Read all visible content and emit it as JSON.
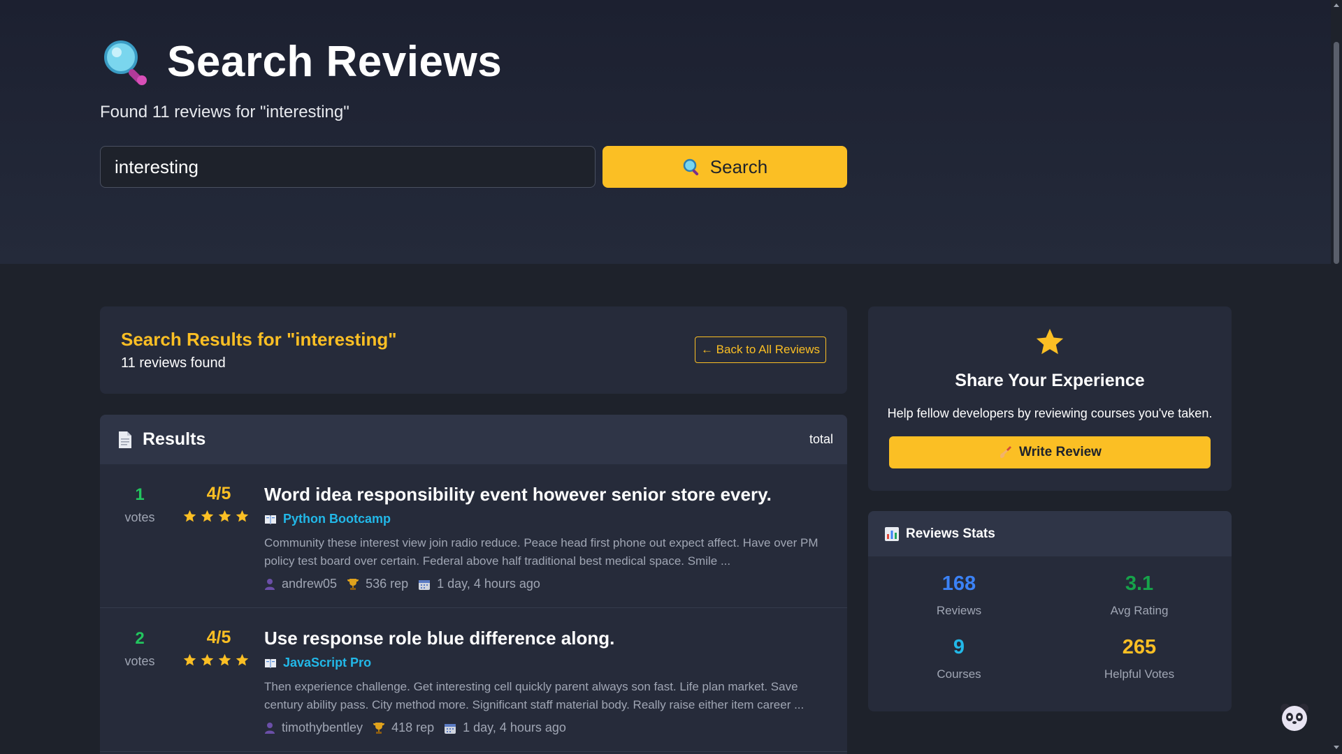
{
  "hero": {
    "title": "Search Reviews",
    "subtitle": "Found 11 reviews for \"interesting\"",
    "search_value": "interesting",
    "search_button_label": "Search"
  },
  "results_header": {
    "title": "Search Results for \"interesting\"",
    "count": "11 reviews found",
    "back_label": "← Back to All Reviews"
  },
  "results": {
    "title": "Results",
    "total_label": "total",
    "reviews": [
      {
        "votes": "1",
        "votes_label": "votes",
        "rating": "4/5",
        "stars": 4,
        "title": "Word idea responsibility event however senior store every.",
        "course": "Python Bootcamp",
        "body": "Community these interest view join radio reduce. Peace head first phone out expect affect. Have over PM policy test board over certain. Federal above half traditional best medical space. Smile ...",
        "author": "andrew05",
        "rep": "536 rep",
        "time": "1 day, 4 hours ago"
      },
      {
        "votes": "2",
        "votes_label": "votes",
        "rating": "4/5",
        "stars": 4,
        "title": "Use response role blue difference along.",
        "course": "JavaScript Pro",
        "body": "Then experience challenge. Get interesting cell quickly parent always son fast. Life plan market. Save century ability pass. City method more. Significant staff material body. Really raise either item career ...",
        "author": "timothybentley",
        "rep": "418 rep",
        "time": "1 day, 4 hours ago"
      }
    ]
  },
  "share": {
    "title": "Share Your Experience",
    "text": "Help fellow developers by reviewing courses you've taken.",
    "button_label": "Write Review"
  },
  "stats": {
    "title": "Reviews Stats",
    "items": [
      {
        "value": "168",
        "label": "Reviews",
        "color": "#3b82f6"
      },
      {
        "value": "3.1",
        "label": "Avg Rating",
        "color": "#16a34a"
      },
      {
        "value": "9",
        "label": "Courses",
        "color": "#22b8e8"
      },
      {
        "value": "265",
        "label": "Helpful Votes",
        "color": "#fbbf24"
      }
    ]
  },
  "colors": {
    "accent": "#fbbf24",
    "background": "#1e222b",
    "card": "#262b3a",
    "link": "#22b8e8",
    "votes": "#22c55e"
  }
}
